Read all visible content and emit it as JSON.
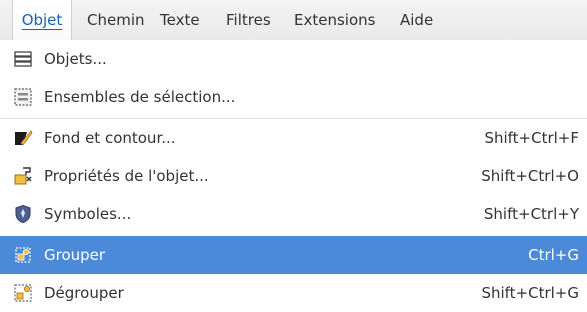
{
  "menubar": {
    "items": [
      "Objet",
      "Chemin",
      "Texte",
      "Filtres",
      "Extensions",
      "Aide"
    ]
  },
  "menu": {
    "items": [
      {
        "label": "Objets...",
        "shortcut": "",
        "icon": "objects-icon"
      },
      {
        "label": "Ensembles de sélection...",
        "shortcut": "",
        "icon": "selection-sets-icon"
      },
      {
        "label": "Fond et contour...",
        "shortcut": "Shift+Ctrl+F",
        "icon": "fill-stroke-icon"
      },
      {
        "label": "Propriétés de l'objet...",
        "shortcut": "Shift+Ctrl+O",
        "icon": "object-properties-icon"
      },
      {
        "label": "Symboles...",
        "shortcut": "Shift+Ctrl+Y",
        "icon": "symbols-icon"
      },
      {
        "label": "Grouper",
        "shortcut": "Ctrl+G",
        "icon": "group-icon"
      },
      {
        "label": "Dégrouper",
        "shortcut": "Shift+Ctrl+G",
        "icon": "ungroup-icon"
      }
    ],
    "highlighted": "Grouper"
  },
  "colors": {
    "highlight": "#4a8ad8",
    "active_menu_text": "#1f5fb0"
  }
}
